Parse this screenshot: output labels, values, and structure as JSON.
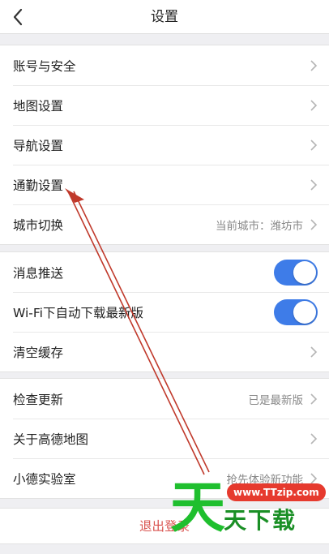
{
  "header": {
    "title": "设置",
    "back_icon": "chevron-left-icon"
  },
  "groups": [
    {
      "items": [
        {
          "label": "账号与安全",
          "value": "",
          "control": "chevron"
        },
        {
          "label": "地图设置",
          "value": "",
          "control": "chevron"
        },
        {
          "label": "导航设置",
          "value": "",
          "control": "chevron"
        },
        {
          "label": "通勤设置",
          "value": "",
          "control": "chevron"
        },
        {
          "label": "城市切换",
          "value": "当前城市：潍坊市",
          "control": "chevron"
        }
      ]
    },
    {
      "items": [
        {
          "label": "消息推送",
          "control": "toggle",
          "on": true
        },
        {
          "label": "Wi-Fi下自动下载最新版",
          "control": "toggle",
          "on": true
        },
        {
          "label": "清空缓存",
          "value": "",
          "control": "chevron"
        }
      ]
    },
    {
      "items": [
        {
          "label": "检查更新",
          "value": "已是最新版",
          "control": "chevron"
        },
        {
          "label": "关于高德地图",
          "value": "",
          "control": "chevron"
        },
        {
          "label": "小德实验室",
          "value": "抢先体验新功能",
          "control": "chevron"
        }
      ]
    }
  ],
  "logout": {
    "label": "退出登录"
  },
  "watermark": {
    "big": "天",
    "url": "www.TTzip.com",
    "text": "天下载"
  },
  "colors": {
    "toggle_on": "#3e7ce8",
    "logout": "#d9534f",
    "annotation_arrow": "#c0392b",
    "watermark_green": "#1fbf2e"
  }
}
